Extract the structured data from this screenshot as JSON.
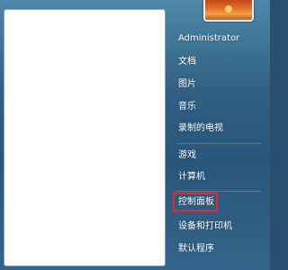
{
  "start_menu": {
    "user_picture": "flower-avatar-icon",
    "right_items": [
      {
        "label": "Administrator"
      },
      {
        "label": "文档"
      },
      {
        "label": "图片"
      },
      {
        "label": "音乐"
      },
      {
        "label": "录制的电视"
      },
      {
        "label": "游戏"
      },
      {
        "label": "计算机"
      },
      {
        "label": "控制面板"
      },
      {
        "label": "设备和打印机"
      },
      {
        "label": "默认程序"
      }
    ],
    "highlight_color": "#e8262c"
  }
}
